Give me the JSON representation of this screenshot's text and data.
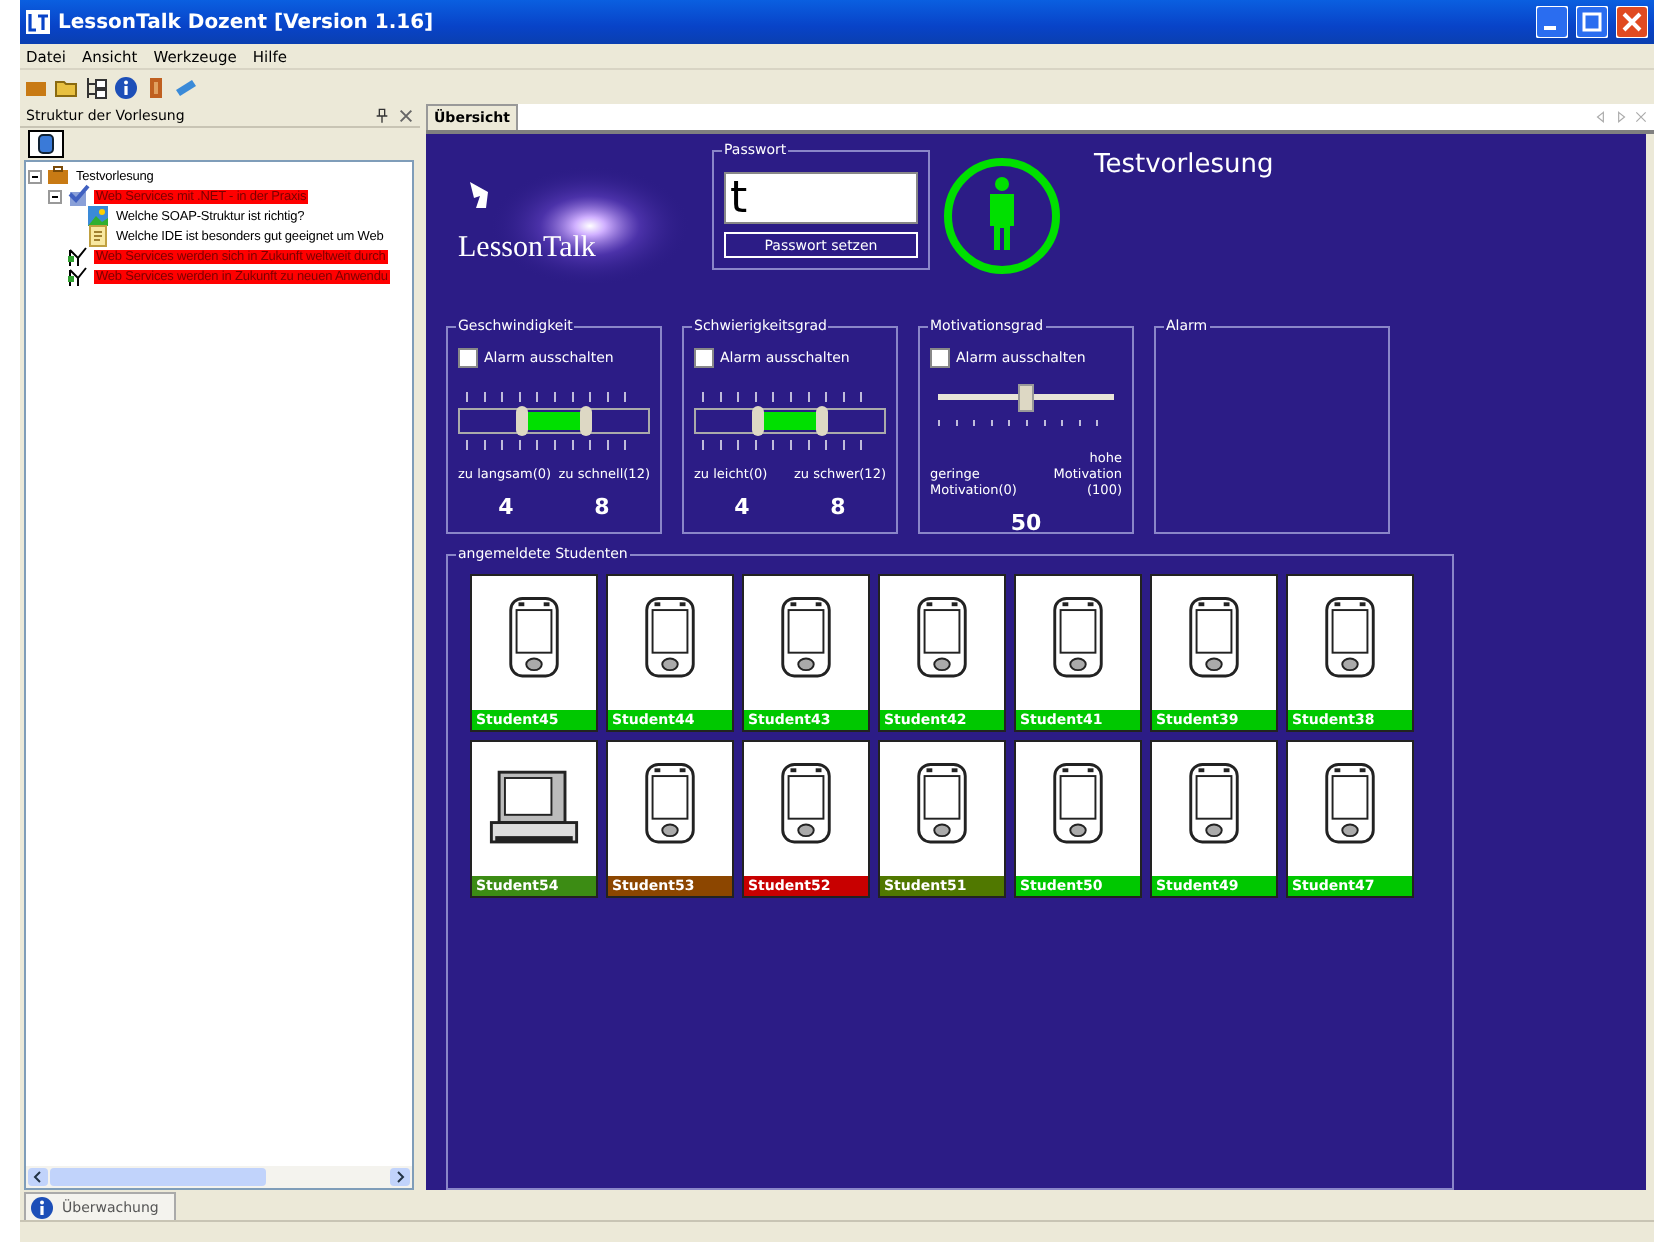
{
  "window": {
    "title": "LessonTalk Dozent [Version 1.16]"
  },
  "menu": [
    "Datei",
    "Ansicht",
    "Werkzeuge",
    "Hilfe"
  ],
  "sidebar": {
    "title": "Struktur der Vorlesung",
    "tree": [
      {
        "label": "Testvorlesung",
        "kind": "folder",
        "highlighted": false,
        "expanded": true,
        "children": [
          {
            "label": "Web Services mit .NET - in der Praxis",
            "kind": "check",
            "highlighted": true,
            "expanded": true,
            "children": [
              {
                "label": "Welche SOAP-Struktur ist richtig?",
                "kind": "picture-question",
                "highlighted": false
              },
              {
                "label": "Welche IDE ist besonders gut geeignet um Web",
                "kind": "note",
                "highlighted": false
              }
            ]
          },
          {
            "label": "Web Services werden sich in Zukunft weltweit durch",
            "kind": "poll",
            "highlighted": true
          },
          {
            "label": "Web Services werden in Zukunft zu neuen Anwendu",
            "kind": "poll",
            "highlighted": true
          }
        ]
      }
    ]
  },
  "main": {
    "tab": {
      "label": "Übersicht",
      "selected": true
    },
    "logo": "LessonTalk",
    "password": {
      "legend": "Passwort",
      "value": "t",
      "button": "Passwort setzen"
    },
    "status_ok": true,
    "title": "Testvorlesung",
    "meters": [
      {
        "kind": "range",
        "legend": "Geschwindigkeit",
        "alarm_label": "Alarm ausschalten",
        "alarm_off": false,
        "handles": [
          {
            "level": 0.333
          },
          {
            "level": 0.667
          }
        ],
        "min_label": "zu langsam(0)",
        "max_label": "zu schnell(12)",
        "values": [
          "4",
          "8"
        ]
      },
      {
        "kind": "range",
        "legend": "Schwierigkeitsgrad",
        "alarm_label": "Alarm ausschalten",
        "alarm_off": false,
        "handles": [
          {
            "level": 0.333
          },
          {
            "level": 0.667
          }
        ],
        "min_label": "zu leicht(0)",
        "max_label": "zu schwer(12)",
        "values": [
          "4",
          "8"
        ]
      },
      {
        "kind": "single",
        "legend": "Motivationsgrad",
        "alarm_label": "Alarm ausschalten",
        "alarm_off": false,
        "level": 0.5,
        "min_label": "geringe Motivation(0)",
        "max_label": "hohe Motivation (100)",
        "values": [
          "50"
        ]
      }
    ],
    "alarm": {
      "legend": "Alarm"
    },
    "students": {
      "legend": "angemeldete Studenten",
      "items": [
        {
          "name": "Student45",
          "kind": "pda",
          "color": "#00c800"
        },
        {
          "name": "Student44",
          "kind": "pda",
          "color": "#00c800"
        },
        {
          "name": "Student43",
          "kind": "pda",
          "color": "#00c800"
        },
        {
          "name": "Student42",
          "kind": "pda",
          "color": "#00c800"
        },
        {
          "name": "Student41",
          "kind": "pda",
          "color": "#00c800"
        },
        {
          "name": "Student39",
          "kind": "pda",
          "color": "#00c800"
        },
        {
          "name": "Student38",
          "kind": "pda",
          "color": "#00c800"
        },
        {
          "name": "Student54",
          "kind": "laptop",
          "color": "#3c8c14"
        },
        {
          "name": "Student53",
          "kind": "pda",
          "color": "#8c4600"
        },
        {
          "name": "Student52",
          "kind": "pda",
          "color": "#c80000"
        },
        {
          "name": "Student51",
          "kind": "pda",
          "color": "#507800"
        },
        {
          "name": "Student50",
          "kind": "pda",
          "color": "#00c800"
        },
        {
          "name": "Student49",
          "kind": "pda",
          "color": "#00c800"
        },
        {
          "name": "Student47",
          "kind": "pda",
          "color": "#00c800"
        }
      ]
    }
  },
  "bottom_tab": {
    "label": "Überwachung",
    "selected": true
  }
}
